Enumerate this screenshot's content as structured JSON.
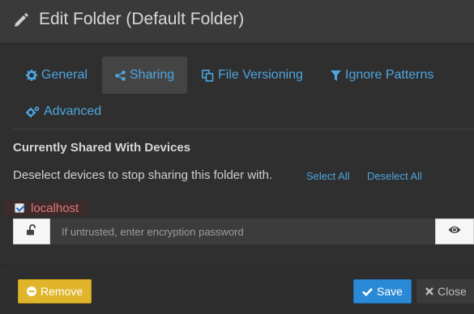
{
  "header": {
    "title": "Edit Folder (Default Folder)",
    "icon": "pencil-icon"
  },
  "tabs": [
    {
      "label": "General",
      "icon": "gear-icon",
      "active": false
    },
    {
      "label": "Sharing",
      "icon": "share-icon",
      "active": true
    },
    {
      "label": "File Versioning",
      "icon": "copy-icon",
      "active": false
    },
    {
      "label": "Ignore Patterns",
      "icon": "filter-icon",
      "active": false
    },
    {
      "label": "Advanced",
      "icon": "gears-icon",
      "active": false
    }
  ],
  "sharing": {
    "section_title": "Currently Shared With Devices",
    "help_text": "Deselect devices to stop sharing this folder with.",
    "select_all": "Select All",
    "deselect_all": "Deselect All",
    "devices": [
      {
        "name": "localhost",
        "checked": true,
        "password_value": "",
        "password_placeholder": "If untrusted, enter encryption password"
      }
    ]
  },
  "footer": {
    "remove_label": "Remove",
    "save_label": "Save",
    "close_label": "Close"
  },
  "colors": {
    "link": "#4da6e0",
    "save": "#2a8ad7",
    "remove": "#e0b52b",
    "device_name": "#e07a7a"
  }
}
